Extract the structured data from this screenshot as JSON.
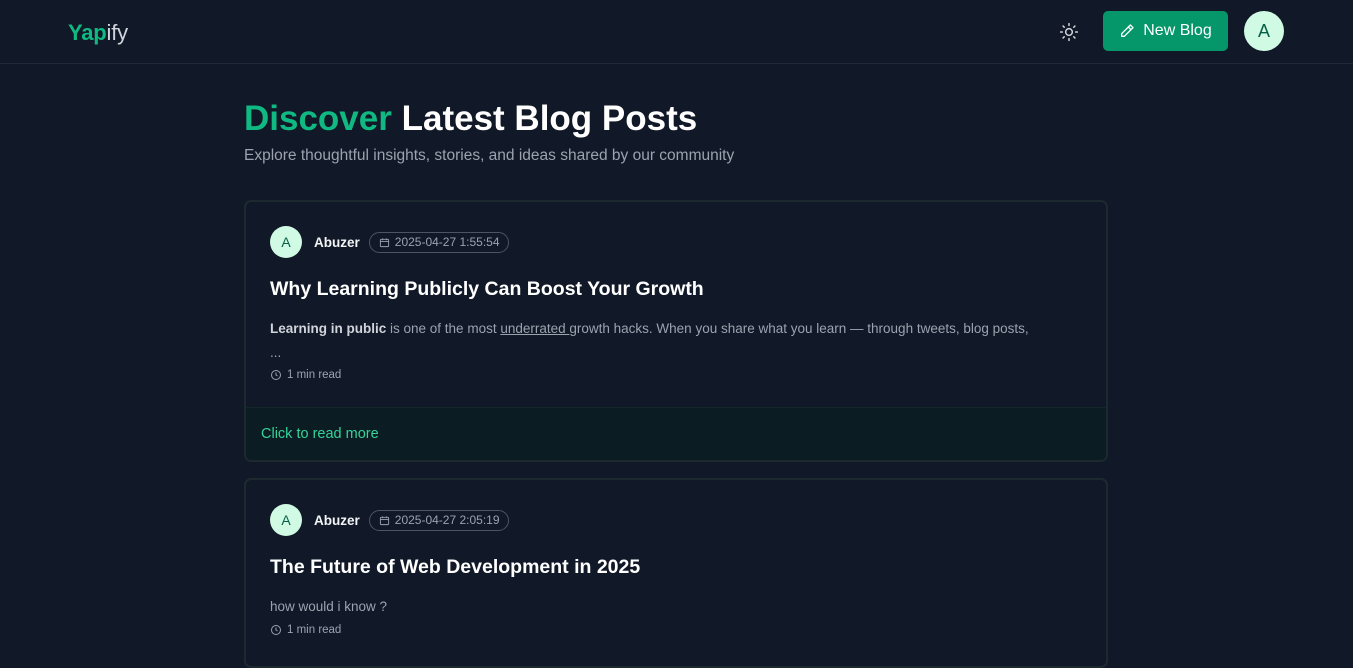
{
  "navbar": {
    "brand_accent": "Yap",
    "brand_rest": "ify",
    "theme_icon": "sun-icon",
    "new_blog_label": "New Blog",
    "user_initial": "A"
  },
  "hero": {
    "title_accent": "Discover",
    "title_rest": "Latest Blog Posts",
    "subtitle": "Explore thoughtful insights, stories, and ideas shared by our community"
  },
  "posts": [
    {
      "author_initial": "A",
      "author": "Abuzer",
      "date": "2025-04-27 1:55:54",
      "title": "Why Learning Publicly Can Boost Your Growth",
      "excerpt_bold": "Learning in public",
      "excerpt_mid": " is one of the most ",
      "excerpt_underline": "underrated ",
      "excerpt_end": "growth hacks. When you share what you learn — through tweets, blog posts,",
      "excerpt_ellipsis": "...",
      "read_time": "1 min read",
      "footer_link": "Click to read more"
    },
    {
      "author_initial": "A",
      "author": "Abuzer",
      "date": "2025-04-27 2:05:19",
      "title": "The Future of Web Development in 2025",
      "excerpt": "how would i know ?",
      "read_time": "1 min read"
    }
  ],
  "colors": {
    "background": "#111827",
    "accent": "#10b981",
    "button": "#059669",
    "avatar_bg": "#d1fae5",
    "footer_link": "#34d399"
  }
}
